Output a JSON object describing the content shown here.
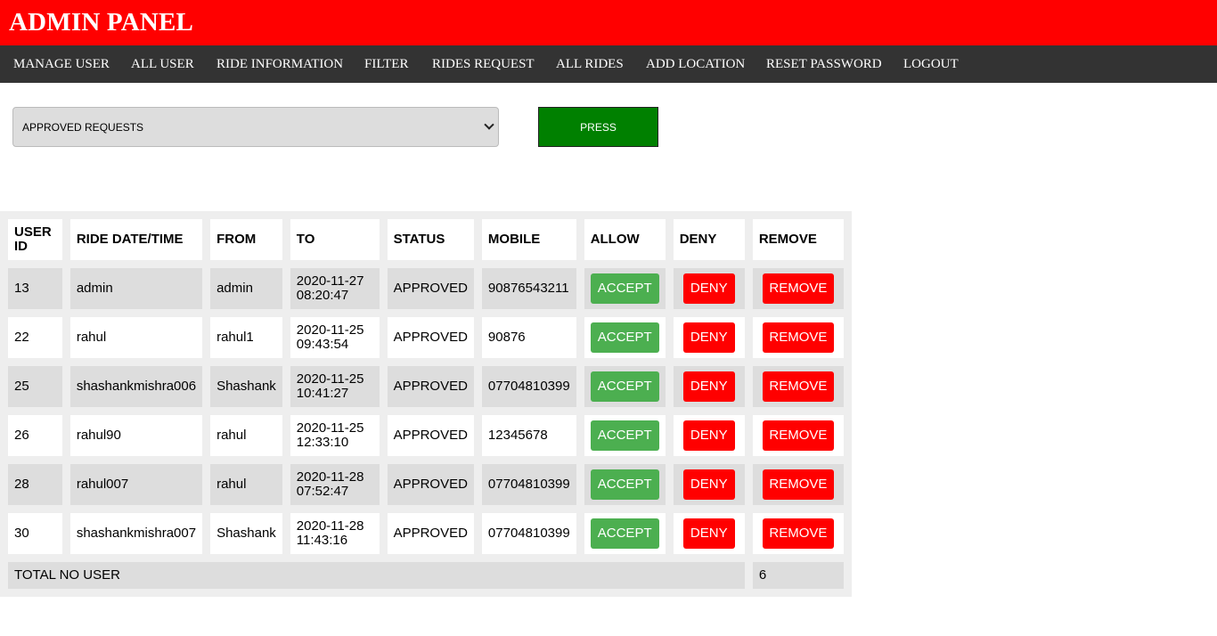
{
  "header": {
    "title": "ADMIN PANEL",
    "bg_color": "#ff0000"
  },
  "nav": {
    "items": [
      "MANAGE USER",
      "ALL USER",
      "RIDE INFORMATION",
      "FILTER",
      "RIDES REQUEST",
      "ALL RIDES",
      "ADD LOCATION",
      "RESET PASSWORD",
      "LOGOUT"
    ]
  },
  "filter": {
    "selected": "APPROVED REQUESTS",
    "press_label": "PRESS",
    "press_color": "#008000"
  },
  "table": {
    "headers": {
      "user_id": "USER ID",
      "ride_datetime": "RIDE DATE/TIME",
      "from": "FROM",
      "to": "TO",
      "status": "STATUS",
      "mobile": "MOBILE",
      "allow": "ALLOW",
      "deny": "DENY",
      "remove": "REMOVE"
    },
    "buttons": {
      "accept": "ACCEPT",
      "deny": "DENY",
      "remove": "REMOVE"
    },
    "rows": [
      {
        "user_id": "13",
        "ride": "admin",
        "from": "admin",
        "to_date": "2020-11-27",
        "to_time": "08:20:47",
        "status": "APPROVED",
        "mobile": "90876543211"
      },
      {
        "user_id": "22",
        "ride": "rahul",
        "from": "rahul1",
        "to_date": "2020-11-25",
        "to_time": "09:43:54",
        "status": "APPROVED",
        "mobile": "90876"
      },
      {
        "user_id": "25",
        "ride": "shashankmishra006",
        "from": "Shashank",
        "to_date": "2020-11-25",
        "to_time": "10:41:27",
        "status": "APPROVED",
        "mobile": "07704810399"
      },
      {
        "user_id": "26",
        "ride": "rahul90",
        "from": "rahul",
        "to_date": "2020-11-25",
        "to_time": "12:33:10",
        "status": "APPROVED",
        "mobile": "12345678"
      },
      {
        "user_id": "28",
        "ride": "rahul007",
        "from": "rahul",
        "to_date": "2020-11-28",
        "to_time": "07:52:47",
        "status": "APPROVED",
        "mobile": "07704810399"
      },
      {
        "user_id": "30",
        "ride": "shashankmishra007",
        "from": "Shashank",
        "to_date": "2020-11-28",
        "to_time": "11:43:16",
        "status": "APPROVED",
        "mobile": "07704810399"
      }
    ],
    "total_label": "TOTAL NO USER",
    "total_value": "6",
    "accept_color": "#4caf50",
    "deny_color": "#ff0000"
  }
}
